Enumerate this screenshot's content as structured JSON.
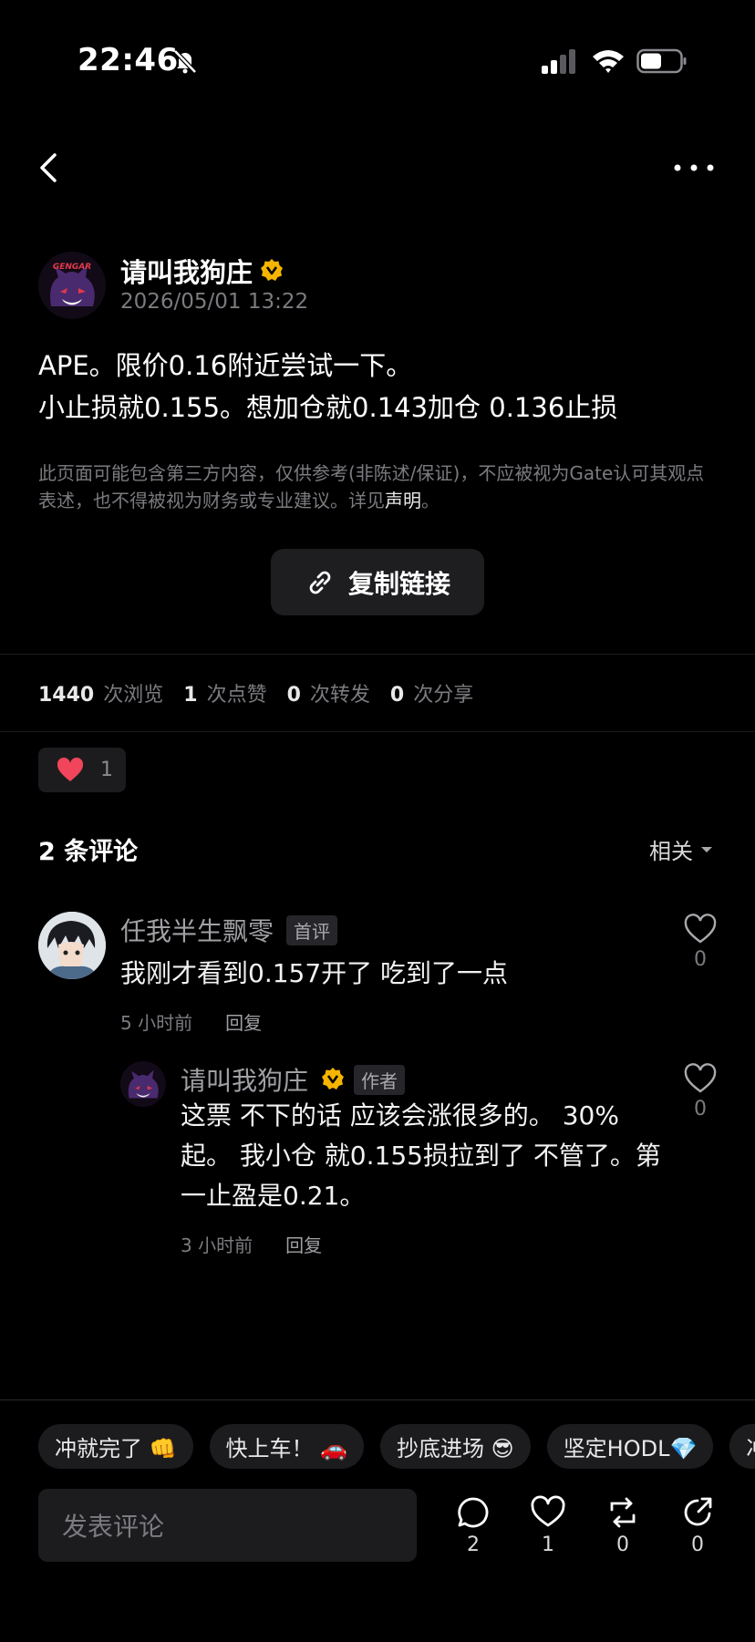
{
  "status": {
    "time": "22:46"
  },
  "author": {
    "name": "请叫我狗庄",
    "date": "2026/05/01 13:22",
    "avatar_text": "GENGAR"
  },
  "post": {
    "line1": "APE。限价0.16附近尝试一下。",
    "line2": "小止损就0.155。想加仓就0.143加仓 0.136止损"
  },
  "disclaimer": {
    "text": "此页面可能包含第三方内容，仅供参考(非陈述/保证)，不应被视为Gate认可其观点表述，也不得被视为财务或专业建议。详见",
    "link": "声明",
    "end": "。"
  },
  "copy_link": {
    "label": "复制链接"
  },
  "stats": {
    "views": "1440",
    "views_label": "次浏览",
    "likes": "1",
    "likes_label": "次点赞",
    "reposts": "0",
    "reposts_label": "次转发",
    "shares": "0",
    "shares_label": "次分享"
  },
  "like_chip": {
    "count": "1"
  },
  "comments_header": {
    "title": "2 条评论",
    "sort": "相关"
  },
  "comments": [
    {
      "name": "任我半生飘零",
      "tag": "首评",
      "text": "我刚才看到0.157开了 吃到了一点",
      "time": "5 小时前",
      "reply": "回复",
      "likes": "0"
    },
    {
      "name": "请叫我狗庄",
      "tag": "作者",
      "text_lines": [
        "这票 不下的话 应该会涨很多的。 30%",
        "起。 我小仓 就0.155损拉到了 不管了。第",
        "一止盈是0.21。"
      ],
      "time": "3 小时前",
      "reply": "回复",
      "likes": "0"
    }
  ],
  "reactions": [
    "冲就完了 👊",
    "快上车！ 🚗",
    "抄底进场 😎",
    "坚定HODL💎",
    "冲"
  ],
  "bottom": {
    "placeholder": "发表评论",
    "comment_count": "2",
    "like_count": "1",
    "repost_count": "0",
    "share_count": "0"
  },
  "colors": {
    "background": "#000000",
    "badge": "#f5b400",
    "heart": "#f0455a"
  }
}
